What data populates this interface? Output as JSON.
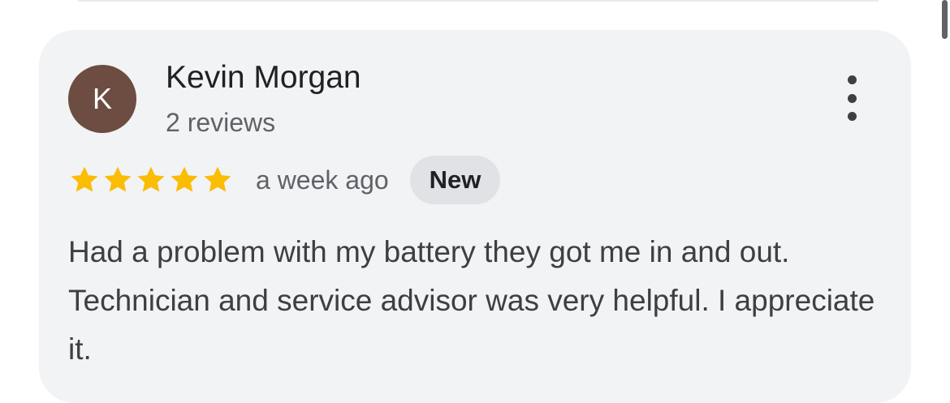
{
  "review": {
    "author_initial": "K",
    "author_name": "Kevin Morgan",
    "author_review_count": "2 reviews",
    "rating": 5,
    "rating_max": 5,
    "date": "a week ago",
    "badge": "New",
    "text": "Had a problem with my battery they got me in and out. Technician and service advisor was very helpful. I appreciate it."
  },
  "icons": {
    "star": "star-icon",
    "more": "more-vert-icon"
  },
  "colors": {
    "avatar_bg": "#6d4c41",
    "star": "#fbbc04",
    "card_bg": "#f1f3f4",
    "badge_bg": "#e0e2e5"
  }
}
